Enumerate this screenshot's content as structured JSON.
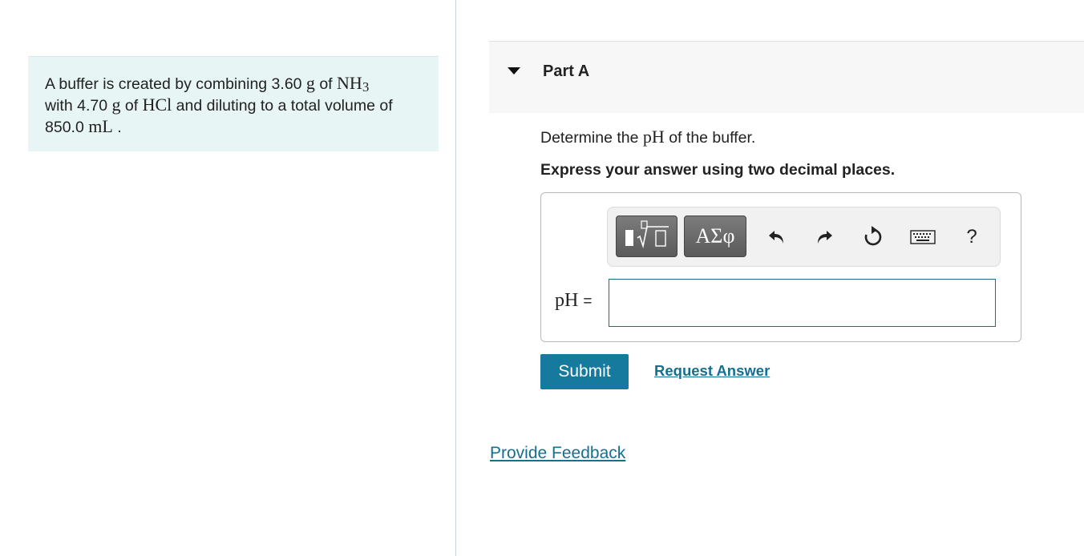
{
  "problem": {
    "text_1": "A buffer is created by combining 3.60 ",
    "unit_g_1": "g",
    "text_2": " of ",
    "compound_1": "NH",
    "compound_1_sub": "3",
    "text_3": "with 4.70 ",
    "unit_g_2": "g",
    "text_4": " of ",
    "compound_2": "HCl",
    "text_5": " and diluting to a total volume of",
    "text_6": "850.0 ",
    "unit_ml": "mL",
    "text_7": " ."
  },
  "part": {
    "title": "Part A",
    "question_pre": "Determine the ",
    "question_math": "pH",
    "question_post": " of the buffer.",
    "instruction": "Express your answer using two decimal places."
  },
  "toolbar": {
    "templates_icon": "templates-icon",
    "symbols_label": "ΑΣφ",
    "undo_icon": "undo-icon",
    "redo_icon": "redo-icon",
    "reset_icon": "reset-icon",
    "keyboard_icon": "keyboard-icon",
    "help_label": "?"
  },
  "answer": {
    "label": "pH",
    "equals": "=",
    "value": ""
  },
  "actions": {
    "submit_label": "Submit",
    "request_answer_label": "Request Answer"
  },
  "footer": {
    "feedback_label": "Provide Feedback"
  },
  "colors": {
    "problem_bg": "#e7f5f5",
    "accent": "#157a9d",
    "link": "#15708f"
  }
}
